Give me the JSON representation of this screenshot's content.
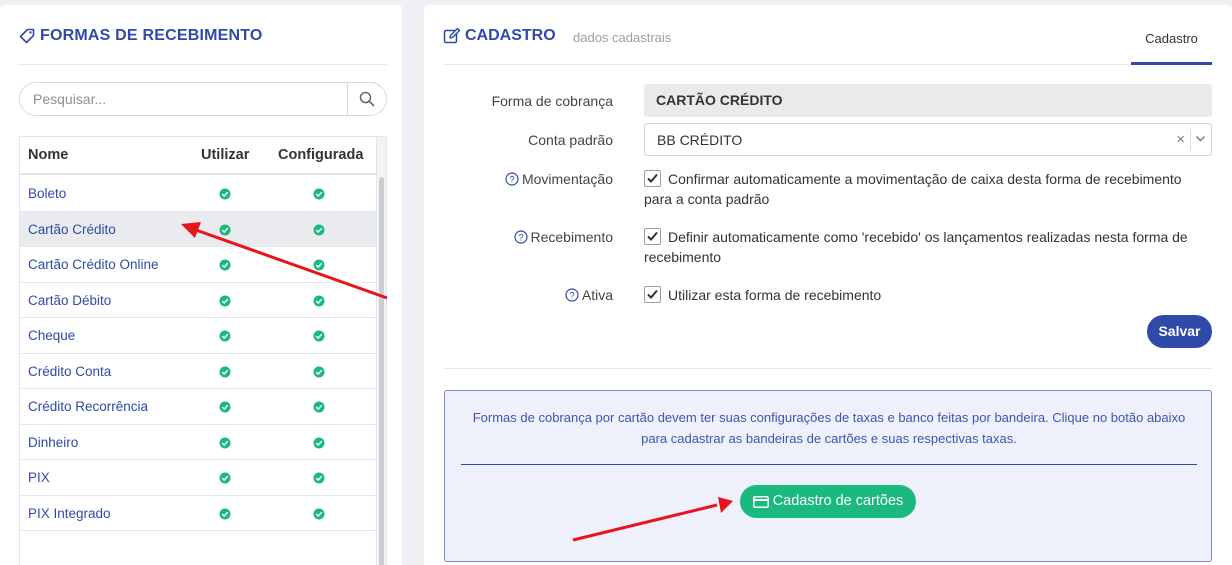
{
  "left": {
    "title": "FORMAS DE RECEBIMENTO",
    "search_placeholder": "Pesquisar...",
    "columns": [
      "Nome",
      "Utilizar",
      "Configurada"
    ],
    "rows": [
      {
        "name": "Boleto",
        "utilizar": true,
        "configurada": true
      },
      {
        "name": "Cartão Crédito",
        "utilizar": true,
        "configurada": true,
        "selected": true
      },
      {
        "name": "Cartão Crédito Online",
        "utilizar": true,
        "configurada": true
      },
      {
        "name": "Cartão Débito",
        "utilizar": true,
        "configurada": true
      },
      {
        "name": "Cheque",
        "utilizar": true,
        "configurada": true
      },
      {
        "name": "Crédito Conta",
        "utilizar": true,
        "configurada": true
      },
      {
        "name": "Crédito Recorrência",
        "utilizar": true,
        "configurada": true
      },
      {
        "name": "Dinheiro",
        "utilizar": true,
        "configurada": true
      },
      {
        "name": "PIX",
        "utilizar": true,
        "configurada": true
      },
      {
        "name": "PIX Integrado",
        "utilizar": true,
        "configurada": true
      }
    ]
  },
  "right": {
    "title": "CADASTRO",
    "subtitle": "dados cadastrais",
    "tab": "Cadastro",
    "forma_label": "Forma de cobrança",
    "forma_value": "CARTÃO CRÉDITO",
    "conta_label": "Conta padrão",
    "conta_value": "BB CRÉDITO",
    "mov_label": "Movimentação",
    "mov_text": "Confirmar automaticamente a movimentação de caixa desta forma de recebimento para a conta padrão",
    "mov_checked": true,
    "rec_label": "Recebimento",
    "rec_text": "Definir automaticamente como 'recebido' os lançamentos realizadas nesta forma de recebimento",
    "rec_checked": true,
    "ativa_label": "Ativa",
    "ativa_text": "Utilizar esta forma de recebimento",
    "ativa_checked": true,
    "salvar_label": "Salvar",
    "info_text": "Formas de cobrança por cartão devem ter suas configurações de taxas e banco feitas por bandeira. Clique no botão abaixo para cadastrar as bandeiras de cartões e suas respectivas taxas.",
    "cartoes_label": "Cadastro de cartões"
  },
  "colors": {
    "brand_blue": "#2f4aa8",
    "success_green": "#1ab97d",
    "annotation_red": "#e8141b"
  }
}
